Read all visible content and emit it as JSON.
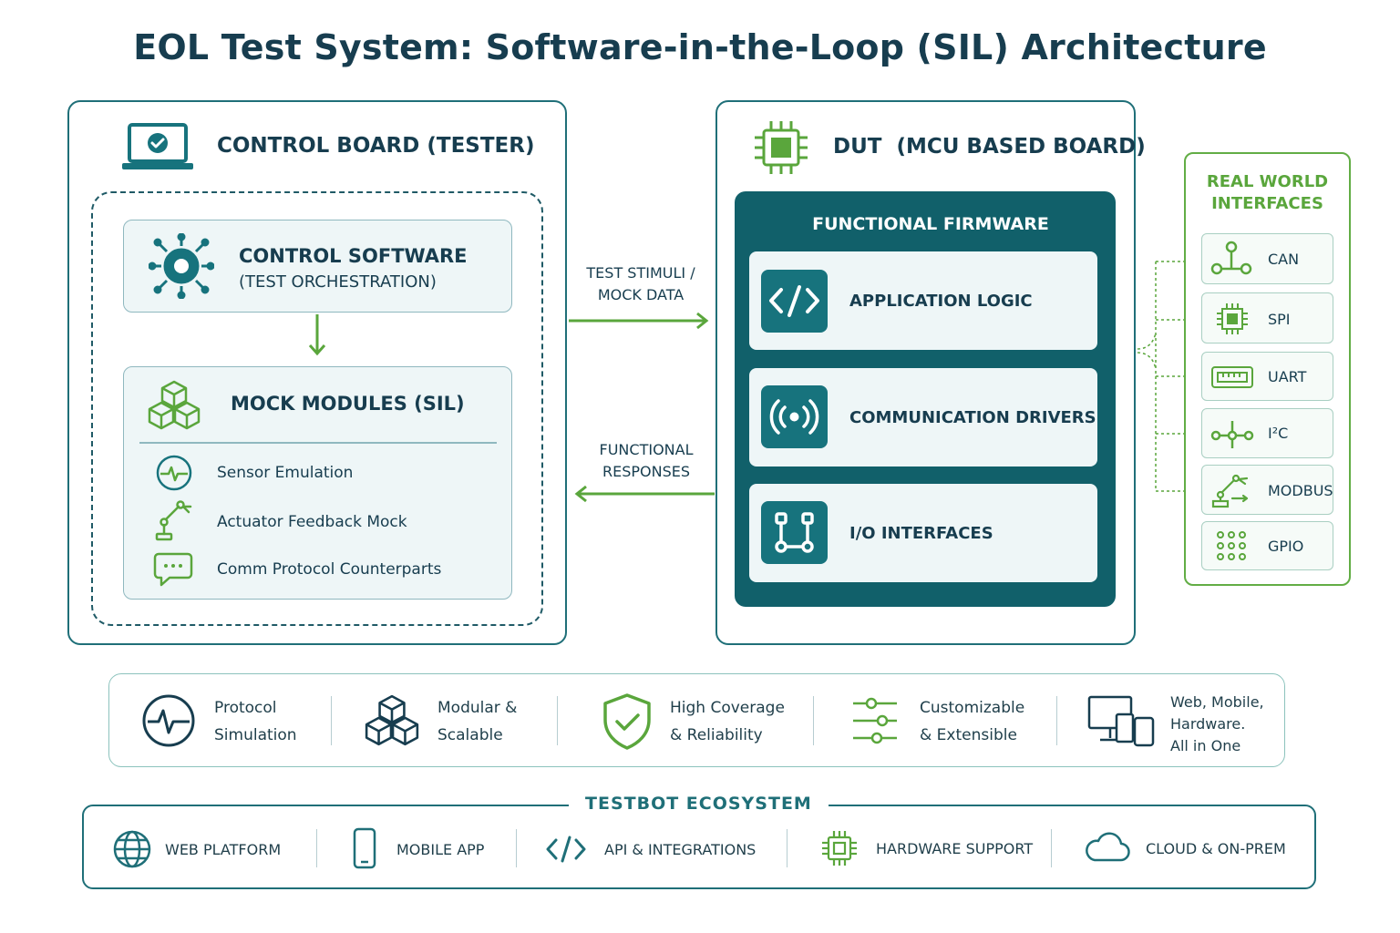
{
  "title": "EOL Test System: Software-in-the-Loop (SIL) Architecture",
  "control_board": {
    "title": "CONTROL BOARD (TESTER)",
    "control_software": {
      "title": "CONTROL SOFTWARE",
      "subtitle": "(TEST ORCHESTRATION)"
    },
    "mock_modules": {
      "title": "MOCK MODULES (SIL)",
      "items": [
        "Sensor Emulation",
        "Actuator Feedback Mock",
        "Comm Protocol Counterparts"
      ]
    }
  },
  "arrows": {
    "forward": [
      "TEST STIMULI /",
      "MOCK DATA"
    ],
    "backward": [
      "FUNCTIONAL",
      "RESPONSES"
    ]
  },
  "dut": {
    "title": "DUT  (MCU BASED BOARD)",
    "firmware_title": "FUNCTIONAL FIRMWARE",
    "layers": [
      "APPLICATION LOGIC",
      "COMMUNICATION DRIVERS",
      "I/O INTERFACES"
    ]
  },
  "real_world": {
    "title": [
      "REAL WORLD",
      "INTERFACES"
    ],
    "items": [
      "CAN",
      "SPI",
      "UART",
      "I²C",
      "MODBUS",
      "GPIO"
    ]
  },
  "features": [
    [
      "Protocol",
      "Simulation"
    ],
    [
      "Modular &",
      "Scalable"
    ],
    [
      "High Coverage",
      "& Reliability"
    ],
    [
      "Customizable",
      "& Extensible"
    ],
    [
      "Web, Mobile,",
      "Hardware.",
      "All in One"
    ]
  ],
  "ecosystem": {
    "title": "TESTBOT ECOSYSTEM",
    "items": [
      "WEB PLATFORM",
      "MOBILE APP",
      "API & INTEGRATIONS",
      "HARDWARE SUPPORT",
      "CLOUD & ON-PREM"
    ]
  },
  "colors": {
    "teal": "#1f6f78",
    "dark_teal": "#11606a",
    "green": "#5aa63c",
    "navy": "#173d4f"
  }
}
